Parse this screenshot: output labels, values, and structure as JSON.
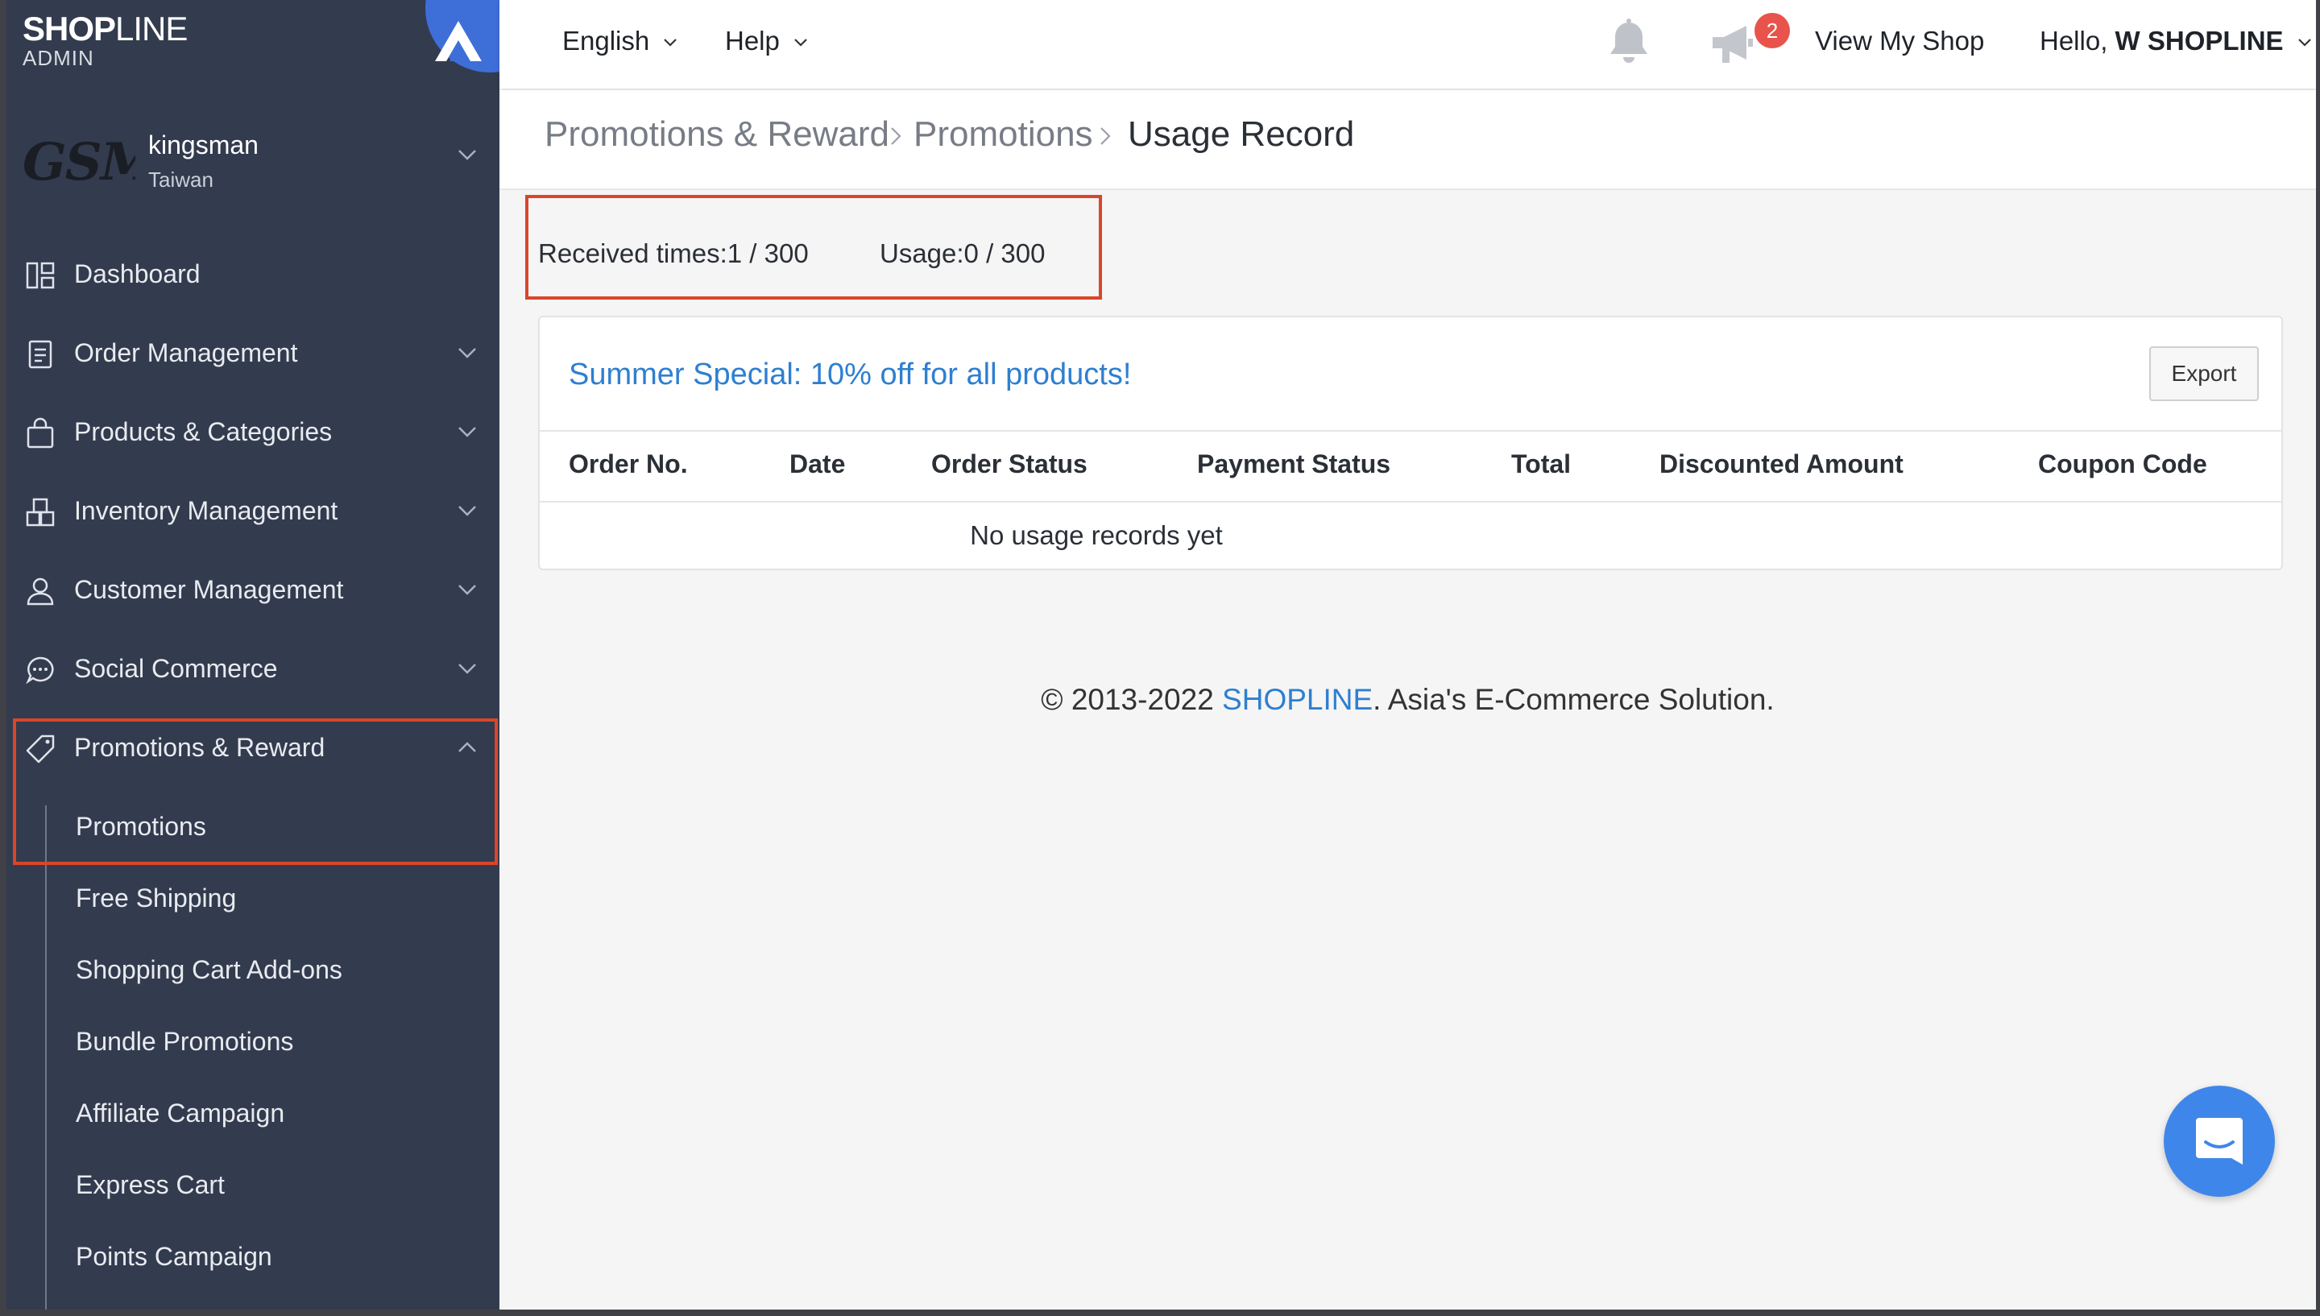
{
  "brand": {
    "name_bold": "SHOP",
    "name_light": "LINE",
    "sub": "ADMIN"
  },
  "store": {
    "logo_text": "GSM",
    "name": "kingsman",
    "region": "Taiwan"
  },
  "nav": {
    "items": [
      {
        "label": "Dashboard",
        "icon": "dashboard-icon"
      },
      {
        "label": "Order Management",
        "icon": "order-icon"
      },
      {
        "label": "Products & Categories",
        "icon": "bag-icon"
      },
      {
        "label": "Inventory Management",
        "icon": "warehouse-icon"
      },
      {
        "label": "Customer Management",
        "icon": "user-icon"
      },
      {
        "label": "Social Commerce",
        "icon": "chat-icon"
      },
      {
        "label": "Promotions & Reward",
        "icon": "tag-icon"
      }
    ],
    "sub_items": [
      "Promotions",
      "Free Shipping",
      "Shopping Cart Add-ons",
      "Bundle Promotions",
      "Affiliate Campaign",
      "Express Cart",
      "Points Campaign"
    ]
  },
  "topbar": {
    "language": "English",
    "help": "Help",
    "notification_count": "2",
    "view_shop": "View My Shop",
    "hello_prefix": "Hello,",
    "hello_user": "W SHOPLINE"
  },
  "breadcrumb": [
    "Promotions & Reward",
    "Promotions",
    "Usage Record"
  ],
  "stats": {
    "received": "Received times:1 / 300",
    "usage": "Usage:0 / 300"
  },
  "panel": {
    "title": "Summer Special: 10% off for all products!",
    "export_label": "Export",
    "columns": [
      "Order No.",
      "Date",
      "Order Status",
      "Payment Status",
      "Total",
      "Discounted Amount",
      "Coupon Code"
    ],
    "empty_message": "No usage records yet"
  },
  "footer": {
    "prefix": "© 2013-2022 ",
    "brand": "SHOPLINE",
    "suffix": ". Asia's E-Commerce Solution."
  },
  "colors": {
    "sidebar": "#333b4e",
    "accent": "#2e7fd0",
    "highlight": "#d9462b",
    "badge": "#e8534b",
    "chat": "#3f86ea"
  }
}
